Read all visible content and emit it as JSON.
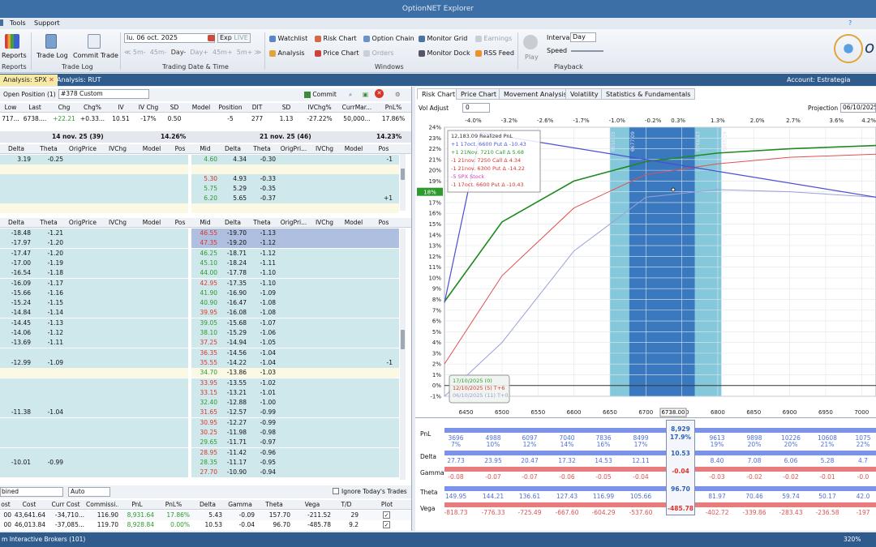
{
  "app": {
    "title": "OptionNET Explorer"
  },
  "menu": [
    "Tools",
    "Support"
  ],
  "ribbon": {
    "reports_label": "Reports",
    "reports_group": "Reports",
    "trade_log": "Trade Log",
    "commit_trade": "Commit Trade",
    "trade_log_group": "Trade Log",
    "date_value": "lu. 06 oct. 2025",
    "exp_label": "Exp",
    "live_label": "LIVE",
    "steps": [
      "5m-",
      "45m-",
      "Day-",
      "Day+",
      "45m+",
      "5m+"
    ],
    "date_group": "Trading Date & Time",
    "windows": [
      "Watchlist",
      "Risk Chart",
      "Option Chain",
      "Monitor Grid",
      "Earnings",
      "Analysis",
      "Price Chart",
      "Orders",
      "Monitor Dock",
      "RSS Feed"
    ],
    "windows_group": "Windows",
    "play": "Play",
    "interval_label": "Interval",
    "interval_value": "Day",
    "speed_label": "Speed",
    "playback_group": "Playback"
  },
  "tabs": [
    {
      "label": "Analysis: SPX",
      "active": true
    },
    {
      "label": "Analysis: RUT",
      "active": false
    }
  ],
  "account": "Account: Estrategia Sentimiento",
  "position": {
    "open_label": "Open Position (1)",
    "custom": "#378 Custom",
    "commit": "Commit",
    "headers": [
      "Low",
      "Last",
      "Chg",
      "Chg%",
      "IV",
      "IV Chg",
      "SD",
      "Model",
      "Position",
      "DIT",
      "SD",
      "IVChg%",
      "CurrMar...",
      "PnL%"
    ],
    "values": [
      "717...",
      "6738....",
      "+22.21",
      "+0.33...",
      "10.51",
      "-17%",
      "0.50",
      "",
      "-5",
      "277",
      "1.13",
      "-27.22%",
      "50,000...",
      "17.86%"
    ]
  },
  "chain_left": {
    "title": "14 nov. 25 (39)",
    "pct": "14.26%",
    "headers": [
      "Delta",
      "Theta",
      "OrigPrice",
      "IVChg",
      "Model",
      "Pos"
    ],
    "calls": [
      [
        "3.19",
        "-0.25"
      ],
      [
        "",
        ""
      ],
      [
        "",
        ""
      ],
      [
        "",
        ""
      ],
      [
        "",
        ""
      ],
      [
        "",
        ""
      ]
    ],
    "puts": [
      [
        "-18.48",
        "-1.21"
      ],
      [
        "-17.97",
        "-1.20"
      ],
      [
        "-17.47",
        "-1.20"
      ],
      [
        "-17.00",
        "-1.19"
      ],
      [
        "-16.54",
        "-1.18"
      ],
      [
        "-16.09",
        "-1.17"
      ],
      [
        "-15.66",
        "-1.16"
      ],
      [
        "-15.24",
        "-1.15"
      ],
      [
        "-14.84",
        "-1.14"
      ],
      [
        "-14.45",
        "-1.13"
      ],
      [
        "-14.06",
        "-1.12"
      ],
      [
        "-13.69",
        "-1.11"
      ],
      [
        "",
        ""
      ],
      [
        "-12.99",
        "-1.09"
      ],
      [
        "",
        ""
      ],
      [
        "",
        ""
      ],
      [
        "",
        ""
      ],
      [
        "",
        ""
      ],
      [
        "-11.38",
        "-1.04"
      ],
      [
        "",
        ""
      ],
      [
        "",
        ""
      ],
      [
        "",
        ""
      ],
      [
        "",
        ""
      ],
      [
        "-10.01",
        "-0.99"
      ],
      [
        "",
        ""
      ]
    ]
  },
  "chain_right": {
    "title": "21 nov. 25 (46)",
    "pct": "14.23%",
    "headers": [
      "Mid",
      "Delta",
      "Theta",
      "OrigPri...",
      "IVChg",
      "Model",
      "Pos"
    ],
    "calls": [
      [
        "4.60",
        "4.34",
        "-0.30",
        "-1"
      ],
      [
        "",
        "",
        "",
        ""
      ],
      [
        "5.30",
        "4.93",
        "-0.33",
        ""
      ],
      [
        "5.75",
        "5.29",
        "-0.35",
        ""
      ],
      [
        "6.20",
        "5.65",
        "-0.37",
        "+1"
      ],
      [
        "",
        "",
        "",
        ""
      ]
    ],
    "puts": [
      [
        "46.55",
        "-19.70",
        "-1.13",
        ""
      ],
      [
        "47.35",
        "-19.20",
        "-1.12",
        ""
      ],
      [
        "46.25",
        "-18.71",
        "-1.12",
        ""
      ],
      [
        "45.10",
        "-18.24",
        "-1.11",
        ""
      ],
      [
        "44.00",
        "-17.78",
        "-1.10",
        ""
      ],
      [
        "42.95",
        "-17.35",
        "-1.10",
        ""
      ],
      [
        "41.90",
        "-16.90",
        "-1.09",
        ""
      ],
      [
        "40.90",
        "-16.47",
        "-1.08",
        ""
      ],
      [
        "39.95",
        "-16.08",
        "-1.08",
        ""
      ],
      [
        "39.05",
        "-15.68",
        "-1.07",
        ""
      ],
      [
        "38.10",
        "-15.29",
        "-1.06",
        ""
      ],
      [
        "37.25",
        "-14.94",
        "-1.05",
        ""
      ],
      [
        "36.35",
        "-14.56",
        "-1.04",
        ""
      ],
      [
        "35.55",
        "-14.22",
        "-1.04",
        "-1"
      ],
      [
        "34.70",
        "-13.86",
        "-1.03",
        ""
      ],
      [
        "33.95",
        "-13.55",
        "-1.02",
        ""
      ],
      [
        "33.15",
        "-13.21",
        "-1.01",
        ""
      ],
      [
        "32.40",
        "-12.88",
        "-1.00",
        ""
      ],
      [
        "31.65",
        "-12.57",
        "-0.99",
        ""
      ],
      [
        "30.95",
        "-12.27",
        "-0.99",
        ""
      ],
      [
        "30.25",
        "-11.98",
        "-0.98",
        ""
      ],
      [
        "29.65",
        "-11.71",
        "-0.97",
        ""
      ],
      [
        "28.95",
        "-11.42",
        "-0.96",
        ""
      ],
      [
        "28.35",
        "-11.17",
        "-0.95",
        ""
      ],
      [
        "27.70",
        "-10.90",
        "-0.94",
        ""
      ]
    ]
  },
  "summary": {
    "combined": "bined",
    "auto": "Auto",
    "ignore": "Ignore Today's Trades",
    "headers": [
      "ost",
      "Cost",
      "Curr Cost",
      "Commissi...",
      "PnL",
      "PnL%",
      "Delta",
      "Gamma",
      "Theta",
      "Vega",
      "T/D",
      "Plot"
    ],
    "rows": [
      [
        "00",
        "43,641.64",
        "-34,710...",
        "116.90",
        "8,931.64",
        "17.86%",
        "5.43",
        "-0.09",
        "157.70",
        "-211.52",
        "29"
      ],
      [
        "00",
        "46,013.84",
        "-37,085...",
        "119.70",
        "8,928.84",
        "0.00%",
        "10.53",
        "-0.04",
        "96.70",
        "-485.78",
        "9.2"
      ]
    ]
  },
  "right_tabs": [
    "Risk Chart",
    "Price Chart",
    "Movement Analysis",
    "Volatility",
    "Statistics & Fundamentals"
  ],
  "vol_adjust": {
    "label": "Vol Adjust",
    "value": "0"
  },
  "projection": {
    "label": "Projection",
    "value": "06/10/2025"
  },
  "chart_data": {
    "type": "line",
    "top_pct": [
      "-4.0%",
      "-3.2%",
      "-2.6%",
      "-1.7%",
      "-1.0%",
      "-0.2%",
      "0.3%",
      "1.3%",
      "2.0%",
      "2.7%",
      "3.6%",
      "4.2%"
    ],
    "x_ticks": [
      6450,
      6500,
      6550,
      6600,
      6650,
      6700,
      6750,
      6800,
      6850,
      6900,
      6950,
      7000
    ],
    "xlim": [
      6420,
      7020
    ],
    "y_ticks": [
      "24%",
      "23%",
      "22%",
      "21%",
      "20%",
      "19%",
      "18%",
      "17%",
      "16%",
      "15%",
      "14%",
      "13%",
      "12%",
      "11%",
      "10%",
      "9%",
      "8%",
      "7%",
      "6%",
      "5%",
      "4%",
      "3%",
      "2%",
      "1%",
      "0%",
      "-1%"
    ],
    "ylim": [
      -1,
      24
    ],
    "y_current": "18%",
    "x_current": "6738.00",
    "legend": [
      {
        "text": "12,183.09 Realized PnL",
        "color": "#333333"
      },
      {
        "text": "+1 17oct. 6600 Put Δ -10.43",
        "color": "#4a5cd6"
      },
      {
        "text": "+1 21Nov. 7210 Call Δ 5.68",
        "color": "#2e9a2e"
      },
      {
        "text": "-1 21nov. 7250 Call Δ 4.34",
        "color": "#d9352d"
      },
      {
        "text": "-1 21nov. 6300 Put Δ -14.22",
        "color": "#d9352d"
      },
      {
        "text": "-5 SPX Stock",
        "color": "#d940c0"
      },
      {
        "text": "-1 17oct. 6600 Put Δ -10.43",
        "color": "#d9352d"
      }
    ],
    "date_legend": [
      {
        "text": "17/10/2025 (0)",
        "color": "#2e9a2e"
      },
      {
        "text": "12/10/2025 (5) T+6",
        "color": "#d9352d"
      },
      {
        "text": "06/10/2025 (11) T+0",
        "color": "#9aa0d8"
      }
    ],
    "band_labels": [
      "6650.35",
      "6677.09",
      "6768.43",
      "6805.19"
    ],
    "series": [
      {
        "name": "17/10/2025 (0)",
        "color": "#1f8a1f",
        "x": [
          6420,
          6500,
          6600,
          6700,
          6800,
          6900,
          7020
        ],
        "y": [
          7.8,
          15.2,
          19.0,
          20.8,
          21.6,
          22.0,
          22.3
        ]
      },
      {
        "name": "12/10/2025 (5) T+6",
        "color": "#e05050",
        "x": [
          6420,
          6500,
          6600,
          6700,
          6800,
          6900,
          7020
        ],
        "y": [
          2.0,
          10.2,
          16.5,
          19.6,
          20.6,
          21.2,
          21.5
        ]
      },
      {
        "name": "06/10/2025 (11) T+0",
        "color": "#9aa0d8",
        "x": [
          6420,
          6500,
          6600,
          6700,
          6800,
          6900,
          7020
        ],
        "y": [
          -1.0,
          4.0,
          12.5,
          17.5,
          18.2,
          18.0,
          17.5
        ]
      }
    ]
  },
  "greeks": {
    "labels": [
      "PnL",
      "Delta",
      "Gamma",
      "Theta",
      "Vega"
    ],
    "current": [
      "8,929",
      "10.53",
      "-0.04",
      "96.70",
      "-485.78"
    ],
    "current_pct": "17.9%",
    "pnl": [
      "3696",
      "4988",
      "6097",
      "7040",
      "7836",
      "8499",
      "9613",
      "9898",
      "10226",
      "10608",
      "1075"
    ],
    "pnl_pct": [
      "7%",
      "10%",
      "12%",
      "14%",
      "16%",
      "17%",
      "19%",
      "20%",
      "20%",
      "21%",
      "22%"
    ],
    "delta": [
      "27.73",
      "23.95",
      "20.47",
      "17.32",
      "14.53",
      "12.11",
      "8.40",
      "7.08",
      "6.06",
      "5.28",
      "4.7"
    ],
    "gamma": [
      "-0.08",
      "-0.07",
      "-0.07",
      "-0.06",
      "-0.05",
      "-0.04",
      "-0.03",
      "-0.02",
      "-0.02",
      "-0.01",
      "-0.0"
    ],
    "theta": [
      "149.95",
      "144.21",
      "136.61",
      "127.43",
      "116.99",
      "105.66",
      "81.97",
      "70.46",
      "59.74",
      "50.17",
      "42.0"
    ],
    "vega": [
      "-818.73",
      "-776.33",
      "-725.49",
      "-667.60",
      "-604.29",
      "-537.60",
      "-402.72",
      "-339.86",
      "-283.43",
      "-236.58",
      "-197"
    ]
  },
  "status": {
    "left": "m Interactive Brokers (101)",
    "zoom": "320%"
  }
}
